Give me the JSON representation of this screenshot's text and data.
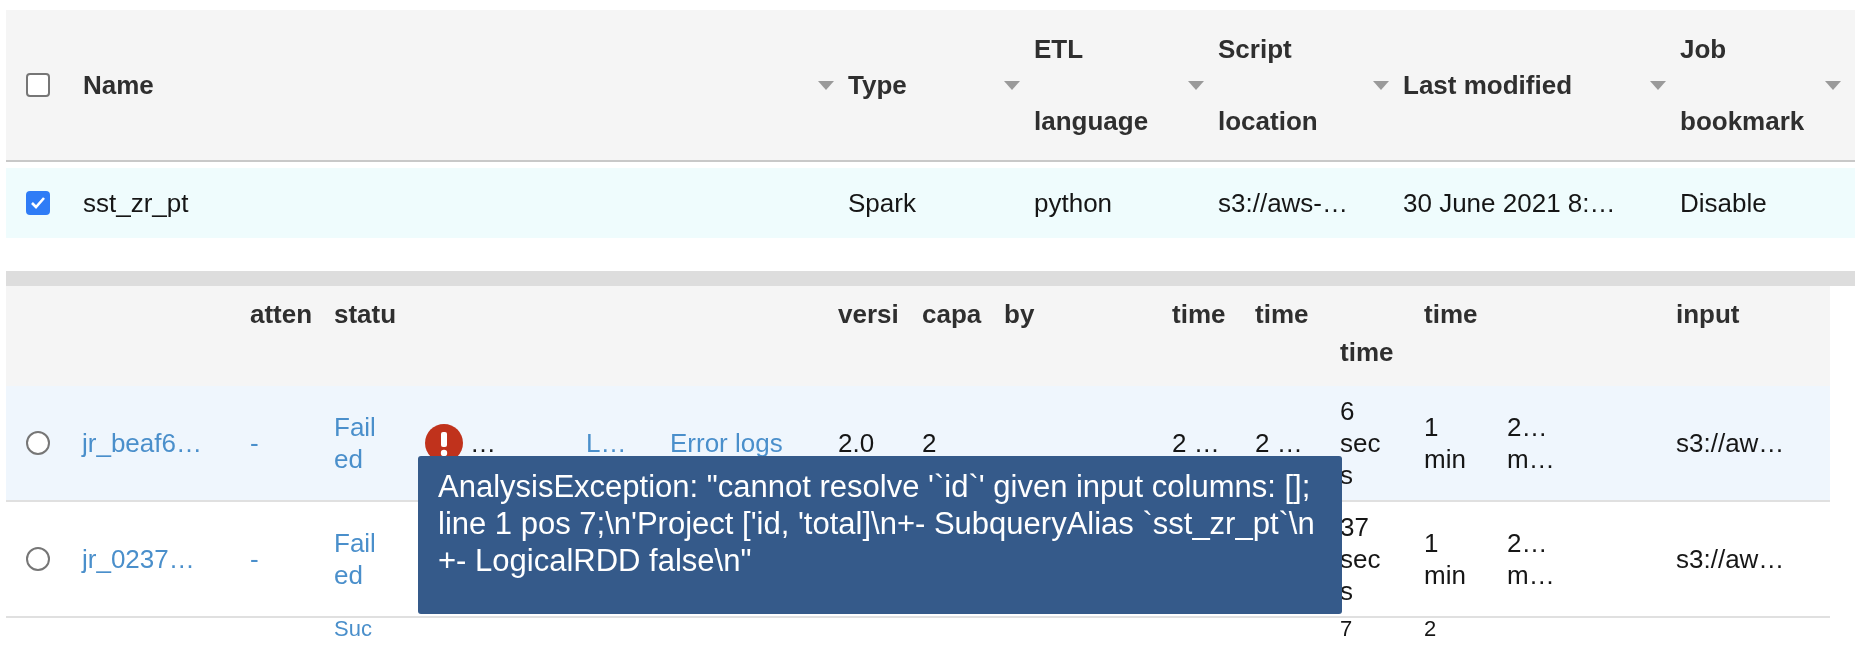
{
  "jobs_table": {
    "select_all": {
      "checked": false
    },
    "columns": [
      {
        "label": "Name",
        "sortable": true
      },
      {
        "label": "Type",
        "sortable": true
      },
      {
        "label": "ETL language",
        "sortable": true
      },
      {
        "label": "Script location",
        "sortable": true
      },
      {
        "label": "Last modified",
        "sortable": true
      },
      {
        "label": "Job bookmark",
        "sortable": true
      }
    ],
    "rows": [
      {
        "selected": true,
        "cells": [
          "sst_zr_pt",
          "Spark",
          "python",
          "s3://aws-…",
          "30 June 2021 8:…",
          "Disable"
        ]
      }
    ]
  },
  "runs_table": {
    "header": {
      "column_3": "atten",
      "column_4": "statu",
      "column_9": "versi",
      "column_10": "capa",
      "column_11": "by",
      "column_12": "time",
      "column_13": "time",
      "column_14": "time",
      "column_15": "time",
      "column_17": "input"
    },
    "rows": [
      {
        "selected": false,
        "highlighted": true,
        "error": true,
        "column_2": "jr_beaf6…",
        "column_3": "-",
        "column_4": "Failed",
        "column_6": "…",
        "column_7": "L…",
        "column_8": "Error logs",
        "column_9": "2.0",
        "column_10": "2",
        "column_12": "2 …",
        "column_13": "2 …",
        "column_14": "6 secs",
        "column_15": "1 min",
        "column_16": "2… m…",
        "column_17": "s3://aw…"
      },
      {
        "selected": false,
        "highlighted": false,
        "error": false,
        "column_2": "jr_0237…",
        "column_3": "-",
        "column_4": "Failed",
        "column_14": "37 secs",
        "column_15": "1 min",
        "column_16": "2… m…",
        "column_17": "s3://aw…"
      },
      {
        "kind": "partial",
        "column_4": "Suc",
        "column_14": "7",
        "column_15": "2"
      }
    ],
    "tooltip": "AnalysisException: \"cannot resolve '`id`' given input columns: []; line 1 pos 7;\\n'Project ['id, 'total]\\n+- SubqueryAlias `sst_zr_pt`\\n +- LogicalRDD false\\n\""
  }
}
